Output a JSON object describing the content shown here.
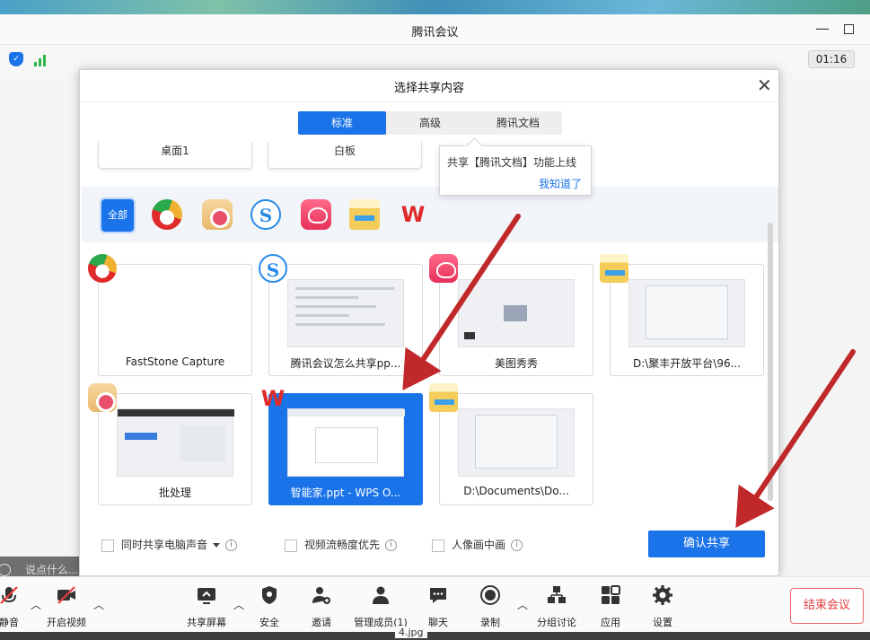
{
  "window": {
    "title": "腾讯会议"
  },
  "status": {
    "timer": "01:16"
  },
  "chat": {
    "placeholder": "说点什么..."
  },
  "dialog": {
    "title": "选择共享内容",
    "tabs": [
      {
        "label": "标准",
        "active": true
      },
      {
        "label": "高级",
        "active": false
      },
      {
        "label": "腾讯文档",
        "active": false
      }
    ],
    "categories": [
      {
        "label": "桌面1"
      },
      {
        "label": "白板"
      }
    ],
    "tooltip": {
      "text": "共享【腾讯文档】功能上线",
      "link": "我知道了"
    },
    "filter": {
      "all_label": "全部",
      "icons": [
        "faststone-icon",
        "batch-icon",
        "sogou-icon",
        "meitu-icon",
        "folder-icon",
        "wps-icon"
      ]
    },
    "windows": [
      {
        "label": "FastStone Capture",
        "icon": "faststone-icon",
        "selected": false
      },
      {
        "label": "腾讯会议怎么共享pp...",
        "icon": "sogou-icon",
        "selected": false
      },
      {
        "label": "美图秀秀",
        "icon": "meitu-icon",
        "selected": false
      },
      {
        "label": "D:\\聚丰开放平台\\96...",
        "icon": "folder-icon",
        "selected": false
      },
      {
        "label": "批处理",
        "icon": "batch-icon",
        "selected": false
      },
      {
        "label": "智能家.ppt - WPS O...",
        "icon": "wps-icon",
        "selected": true
      },
      {
        "label": "D:\\Documents\\Do...",
        "icon": "folder-icon",
        "selected": false
      }
    ],
    "options": {
      "share_audio": "同时共享电脑声音",
      "video_smooth": "视频流畅度优先",
      "pip": "人像画中画"
    },
    "confirm": "确认共享"
  },
  "toolbar": {
    "items": [
      {
        "label": "静音",
        "icon": "mic-off-icon"
      },
      {
        "label": "开启视频",
        "icon": "camera-off-icon"
      },
      {
        "label": "共享屏幕",
        "icon": "screen-share-icon"
      },
      {
        "label": "安全",
        "icon": "shield-icon"
      },
      {
        "label": "邀请",
        "icon": "invite-icon"
      },
      {
        "label": "管理成员(1)",
        "icon": "members-icon"
      },
      {
        "label": "聊天",
        "icon": "chat-icon"
      },
      {
        "label": "录制",
        "icon": "record-icon"
      },
      {
        "label": "分组讨论",
        "icon": "breakout-icon"
      },
      {
        "label": "应用",
        "icon": "apps-icon"
      },
      {
        "label": "设置",
        "icon": "settings-icon"
      }
    ],
    "end": "结束会议"
  },
  "taskbar": {
    "text": "4.jpg"
  },
  "colors": {
    "accent": "#1a73e8",
    "danger": "#e53a3a",
    "arrow": "#c0282a"
  }
}
